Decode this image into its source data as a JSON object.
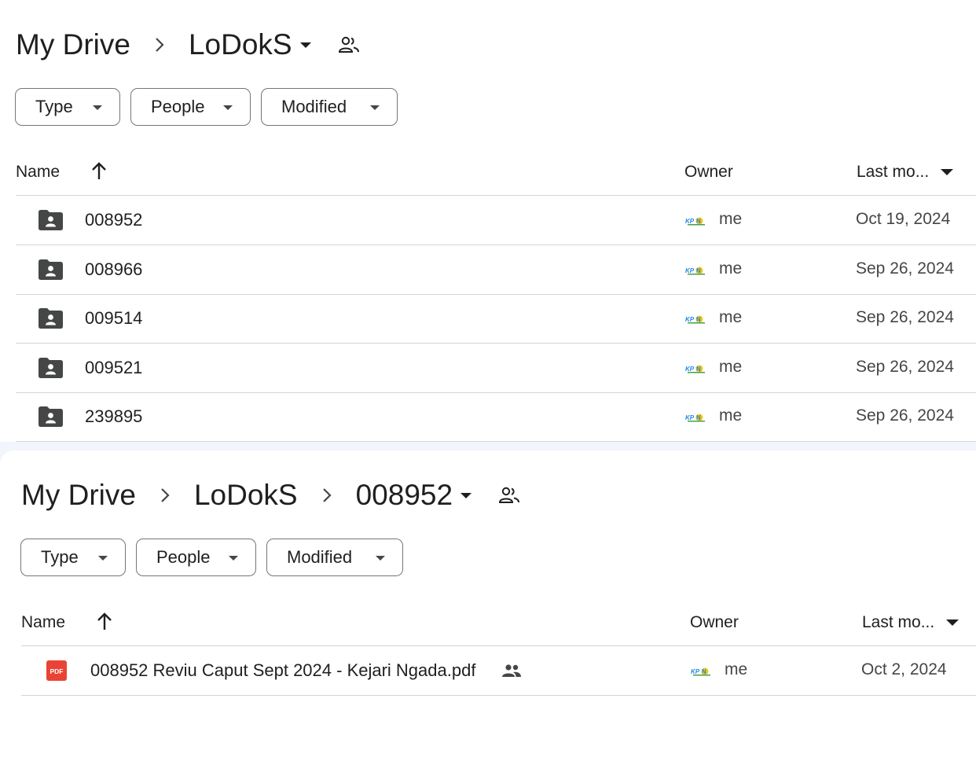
{
  "panel1": {
    "breadcrumbs": {
      "root": "My Drive",
      "current": "LoDokS"
    },
    "filters": {
      "type": "Type",
      "people": "People",
      "modified": "Modified"
    },
    "columns": {
      "name": "Name",
      "owner": "Owner",
      "last_modified": "Last mo..."
    },
    "rows": [
      {
        "name": "008952",
        "owner": "me",
        "date": "Oct 19, 2024",
        "icon": "shared-folder-icon"
      },
      {
        "name": "008966",
        "owner": "me",
        "date": "Sep 26, 2024",
        "icon": "shared-folder-icon"
      },
      {
        "name": "009514",
        "owner": "me",
        "date": "Sep 26, 2024",
        "icon": "shared-folder-icon"
      },
      {
        "name": "009521",
        "owner": "me",
        "date": "Sep 26, 2024",
        "icon": "shared-folder-icon"
      },
      {
        "name": "239895",
        "owner": "me",
        "date": "Sep 26, 2024",
        "icon": "shared-folder-icon"
      }
    ]
  },
  "panel2": {
    "breadcrumbs": {
      "root": "My Drive",
      "middle": "LoDokS",
      "current": "008952"
    },
    "filters": {
      "type": "Type",
      "people": "People",
      "modified": "Modified"
    },
    "columns": {
      "name": "Name",
      "owner": "Owner",
      "last_modified": "Last mo..."
    },
    "rows": [
      {
        "name": "008952 Reviu Caput Sept 2024 - Kejari Ngada.pdf",
        "owner": "me",
        "date": "Oct 2, 2024",
        "icon": "pdf-icon",
        "file_badge": "PDF"
      }
    ]
  },
  "colors": {
    "pdf_red": "#ea4335",
    "folder_dark": "#444746",
    "divider": "#d4d4d4",
    "chip_border": "#747775"
  }
}
